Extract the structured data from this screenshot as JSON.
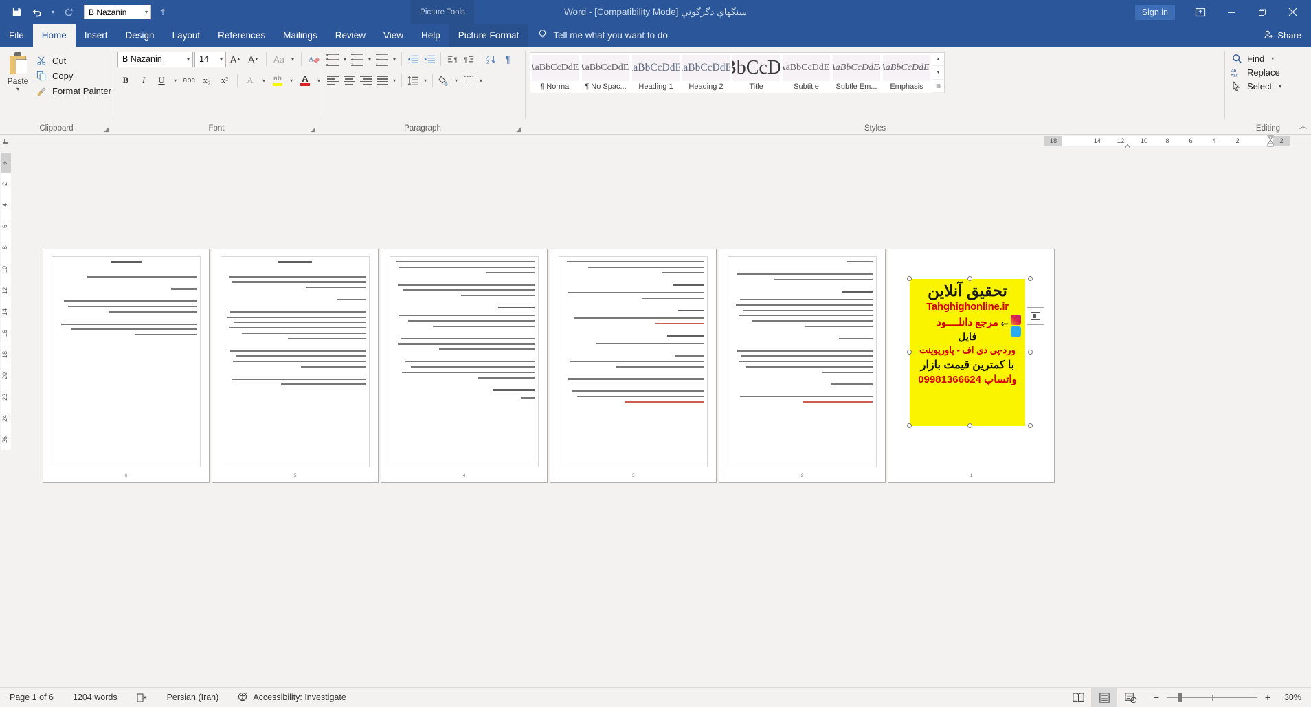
{
  "titlebar": {
    "document_title": "سنگهاي دگرگوني [Compatibility Mode]  -  Word",
    "context_tab_title": "Picture Tools",
    "signin_label": "Sign in",
    "quick_access": {
      "save_icon": "save-icon",
      "undo_icon": "undo-icon",
      "redo_icon": "redo-icon",
      "font_value": "B Nazanin",
      "more_icon": "customize-qat-icon"
    },
    "window": {
      "ribbon_display_icon": "ribbon-display-options-icon",
      "minimize_icon": "minimize-icon",
      "restore_icon": "restore-icon",
      "close_icon": "close-icon"
    }
  },
  "tabs": [
    {
      "label": "File",
      "active": false,
      "kind": "file"
    },
    {
      "label": "Home",
      "active": true,
      "kind": "normal"
    },
    {
      "label": "Insert",
      "active": false,
      "kind": "normal"
    },
    {
      "label": "Design",
      "active": false,
      "kind": "normal"
    },
    {
      "label": "Layout",
      "active": false,
      "kind": "normal"
    },
    {
      "label": "References",
      "active": false,
      "kind": "normal"
    },
    {
      "label": "Mailings",
      "active": false,
      "kind": "normal"
    },
    {
      "label": "Review",
      "active": false,
      "kind": "normal"
    },
    {
      "label": "View",
      "active": false,
      "kind": "normal"
    },
    {
      "label": "Help",
      "active": false,
      "kind": "normal"
    },
    {
      "label": "Picture Format",
      "active": false,
      "kind": "context"
    }
  ],
  "tellme": {
    "label": "Tell me what you want to do",
    "icon": "lightbulb-icon"
  },
  "share": {
    "label": "Share",
    "icon": "share-person-icon"
  },
  "ribbon": {
    "clipboard": {
      "group_label": "Clipboard",
      "paste_label": "Paste",
      "cut_label": "Cut",
      "copy_label": "Copy",
      "format_painter_label": "Format Painter"
    },
    "font": {
      "group_label": "Font",
      "font_name": "B Nazanin",
      "font_size": "14",
      "grow_font_icon": "grow-font-icon",
      "shrink_font_icon": "shrink-font-icon",
      "change_case_label": "Aa",
      "clear_formatting_icon": "clear-formatting-icon",
      "bold_label": "B",
      "italic_label": "I",
      "underline_label": "U",
      "strikethrough_label": "abc",
      "subscript_label": "x₂",
      "superscript_label": "x²",
      "text_effects_label": "A",
      "highlight_label": "ab",
      "font_color_label": "A",
      "font_color_hex": "#e02020"
    },
    "paragraph": {
      "group_label": "Paragraph",
      "bullets_icon": "bullets-icon",
      "numbering_icon": "numbering-icon",
      "multilevel_icon": "multilevel-list-icon",
      "decrease_indent_icon": "decrease-indent-icon",
      "increase_indent_icon": "increase-indent-icon",
      "ltr_icon": "left-to-right-icon",
      "rtl_icon": "right-to-left-icon",
      "sort_icon": "sort-icon",
      "show_marks_icon": "show-formatting-marks-icon",
      "align_left_icon": "align-left-icon",
      "align_center_icon": "align-center-icon",
      "align_right_icon": "align-right-icon",
      "justify_icon": "justify-icon",
      "line_spacing_icon": "line-spacing-icon",
      "shading_icon": "shading-icon",
      "borders_icon": "borders-icon"
    },
    "styles": {
      "group_label": "Styles",
      "items": [
        {
          "preview": "AaBbCcDdEe",
          "name": "¶ Normal"
        },
        {
          "preview": "AaBbCcDdEe",
          "name": "¶ No Spac..."
        },
        {
          "preview": "AaBbCcDdEe",
          "name": "Heading 1"
        },
        {
          "preview": "AaBbCcDdEe",
          "name": "Heading 2"
        },
        {
          "preview": "AaBbCcDdEe",
          "name": "Title"
        },
        {
          "preview": "AaBbCcDdEe",
          "name": "Subtitle"
        },
        {
          "preview": "AaBbCcDdEe",
          "name": "Subtle Em..."
        },
        {
          "preview": "AaBbCcDdEe",
          "name": "Emphasis"
        }
      ]
    },
    "editing": {
      "group_label": "Editing",
      "find_label": "Find",
      "replace_label": "Replace",
      "select_label": "Select"
    }
  },
  "ruler": {
    "horizontal_marks": [
      "18",
      "",
      "14",
      "12",
      "10",
      "8",
      "6",
      "4",
      "2",
      "",
      "2"
    ],
    "vertical_marks": [
      "2",
      "2",
      "4",
      "6",
      "8",
      "10",
      "12",
      "14",
      "16",
      "18",
      "20",
      "22",
      "24",
      "26"
    ]
  },
  "document": {
    "pages": [
      {
        "number": "6",
        "type": "text"
      },
      {
        "number": "5",
        "type": "text"
      },
      {
        "number": "4",
        "type": "text"
      },
      {
        "number": "3",
        "type": "text"
      },
      {
        "number": "2",
        "type": "text"
      },
      {
        "number": "1",
        "type": "image"
      }
    ],
    "selected_image": {
      "line1": "تحقیق آنلاین",
      "url": "Tahghighonline.ir",
      "line3": "مرجع دانلــــود",
      "line4": "فایل",
      "line5": "ورد-پی دی اف - پاورپوینت",
      "line6": "با کمترین قیمت بازار",
      "line7": "واتساپ 09981366624",
      "background_hex": "#fbf400",
      "accent_hex": "#d40000",
      "instagram_icon": "instagram-icon",
      "telegram_icon": "telegram-icon",
      "layout_options_icon": "layout-options-icon",
      "rotate_handle_icon": "rotate-handle-icon"
    }
  },
  "statusbar": {
    "page_label": "Page 1 of 6",
    "word_count": "1204 words",
    "proofing_icon": "proofing-errors-icon",
    "language": "Persian (Iran)",
    "accessibility": "Accessibility: Investigate",
    "accessibility_icon": "accessibility-icon",
    "views": [
      {
        "name": "read-mode",
        "icon": "read-mode-icon",
        "active": false
      },
      {
        "name": "print-layout",
        "icon": "print-layout-icon",
        "active": true
      },
      {
        "name": "web-layout",
        "icon": "web-layout-icon",
        "active": false
      }
    ],
    "zoom_out_label": "−",
    "zoom_in_label": "+",
    "zoom_level": "30%"
  }
}
